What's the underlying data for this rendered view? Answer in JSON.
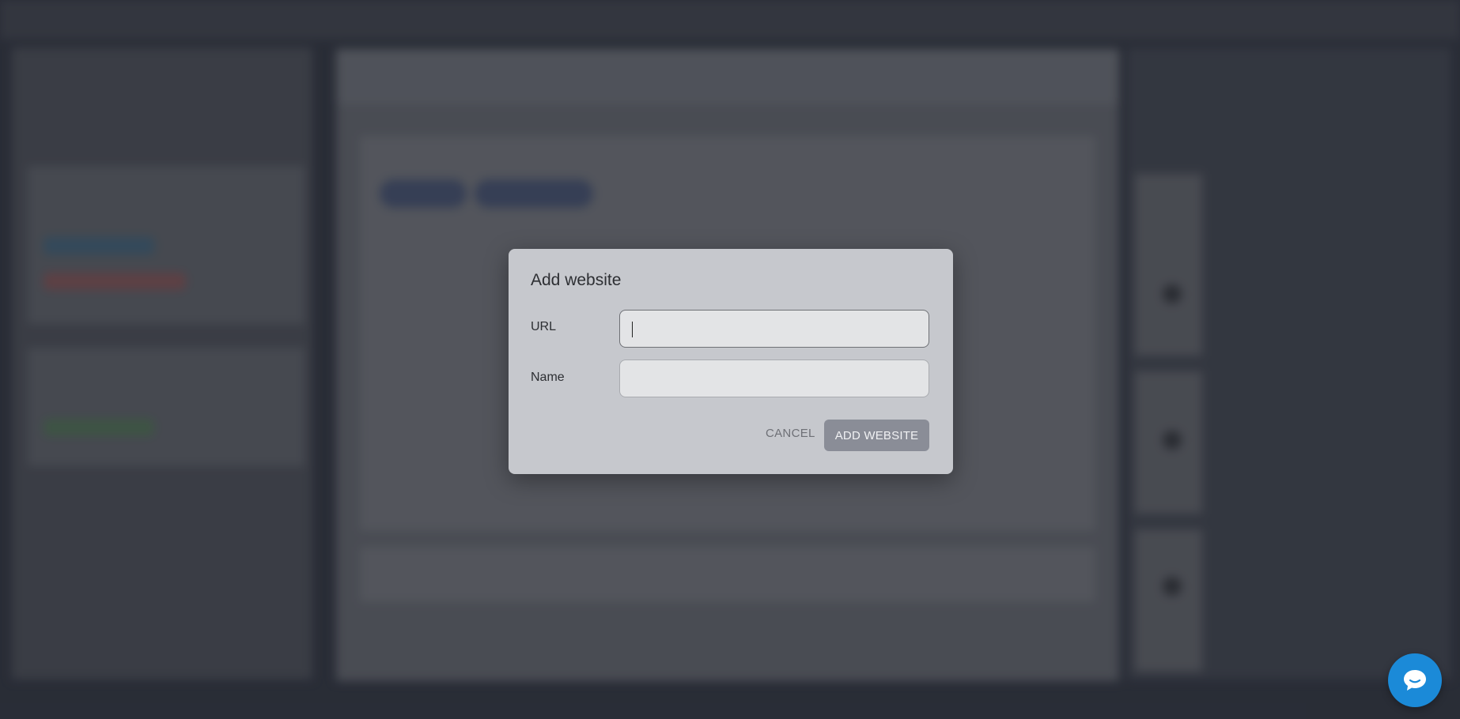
{
  "dialog": {
    "title": "Add website",
    "url_label": "URL",
    "url_value": "",
    "name_label": "Name",
    "name_value": "",
    "cancel_label": "CANCEL",
    "submit_label": "ADD WEBSITE"
  },
  "colors": {
    "dialog_bg": "#c6c8cd",
    "submit_bg": "#8a8d97",
    "chat_bubble": "#1b8ad8"
  },
  "icons": {
    "chat": "chat-bubble-icon"
  }
}
